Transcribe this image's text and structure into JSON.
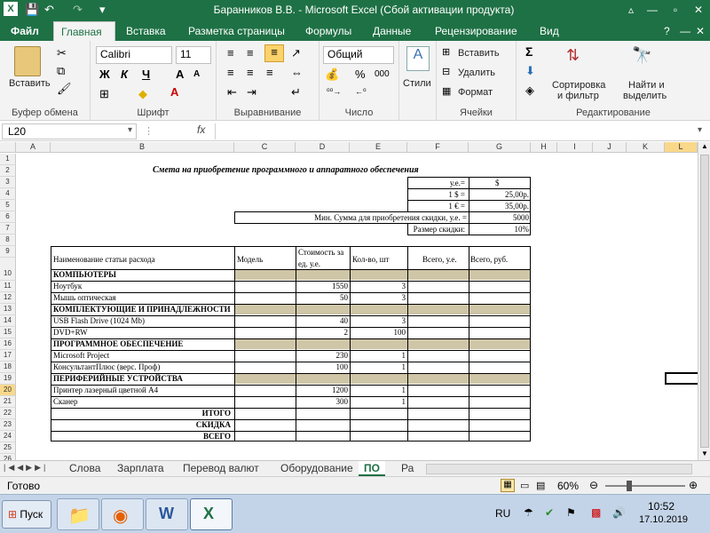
{
  "window": {
    "title": "Баранников В.В.  -  Microsoft Excel (Сбой активации продукта)",
    "minimize": "—",
    "restore": "▫",
    "close": "✕"
  },
  "tabs": [
    "Файл",
    "Главная",
    "Вставка",
    "Разметка страницы",
    "Формулы",
    "Данные",
    "Рецензирование",
    "Вид"
  ],
  "ribbon": {
    "paste_label": "Вставить",
    "clipboard_group": "Буфер обмена",
    "font_name": "Calibri",
    "font_size": "11",
    "bold": "Ж",
    "italic": "К",
    "underline": "Ч",
    "font_group": "Шрифт",
    "align_group": "Выравнивание",
    "number_format": "Общий",
    "percent": "%",
    "thousands": "000",
    "number_group": "Число",
    "styles_label": "Стили",
    "insert_label": "Вставить",
    "delete_label": "Удалить",
    "format_label": "Формат",
    "cells_group": "Ячейки",
    "sigma": "Σ",
    "sort_label": "Сортировка и фильтр",
    "sort_line1": "Сортировка",
    "sort_line2": "и фильтр",
    "find_line1": "Найти и",
    "find_line2": "выделить",
    "editing_group": "Редактирование"
  },
  "formula_bar": {
    "name_box": "L20",
    "fx": "fx",
    "value": ""
  },
  "columns": [
    "A",
    "B",
    "C",
    "D",
    "E",
    "F",
    "G",
    "H",
    "I",
    "J",
    "K",
    "L"
  ],
  "rows": [
    "1",
    "2",
    "3",
    "4",
    "5",
    "6",
    "7",
    "8",
    "9",
    "10",
    "11",
    "12",
    "13",
    "14",
    "15",
    "16",
    "17",
    "18",
    "19",
    "20",
    "21",
    "22",
    "23",
    "24",
    "25",
    "26",
    "27"
  ],
  "sheet": {
    "title": "Смета на приобретение программного и аппаратного обеспечения",
    "rate_hdr_label": "у.е.=",
    "rate_hdr_value": "$",
    "usd_label": "1 $ =",
    "usd_value": "25,00р.",
    "eur_label": "1 € =",
    "eur_value": "35,00р.",
    "min_sum_label": "Мин. Сумма для приобретения скидки, у.е. =",
    "min_sum_value": "5000",
    "discount_label": "Размер скидки:",
    "discount_value": "10%",
    "headers": {
      "name": "Наименование статьи расхода",
      "model": "Модель",
      "cost_l1": "Стоимость за",
      "cost_l2": "ед. у.е.",
      "qty": "Кол-во, шт",
      "total_ue": "Всего, у.е.",
      "total_rub": "Всего, руб."
    },
    "sections": {
      "computers": "КОМПЬЮТЕРЫ",
      "components": "КОМПЛЕКТУЮЩИЕ И ПРИНАДЛЕЖНОСТИ",
      "software": "ПРОГРАММНОЕ ОБЕСПЕЧЕНИЕ",
      "peripherals": "ПЕРИФЕРИЙНЫЕ УСТРОЙСТВА"
    },
    "items": [
      {
        "name": "Ноутбук",
        "price": "1550",
        "qty": "3"
      },
      {
        "name": "Мышь оптическая",
        "price": "50",
        "qty": "3"
      },
      {
        "name": "USB Flash Drive (1024 Mb)",
        "price": "40",
        "qty": "3"
      },
      {
        "name": "DVD+RW",
        "price": "2",
        "qty": "100"
      },
      {
        "name": "Microsoft Project",
        "price": "230",
        "qty": "1"
      },
      {
        "name": "КонсультантПлюс (верс. Проф)",
        "price": "100",
        "qty": "1"
      },
      {
        "name": "Принтер лазерный цветной А4",
        "price": "1200",
        "qty": "1"
      },
      {
        "name": "Сканер",
        "price": "300",
        "qty": "1"
      }
    ],
    "total": "ИТОГО",
    "discount": "СКИДКА",
    "grand_total": "ВСЕГО"
  },
  "sheet_tabs": [
    "Слова",
    "Зарплата",
    "Перевод валют",
    "Оборудование",
    "ПО",
    "Ра"
  ],
  "status": {
    "ready": "Готово",
    "zoom": "60%"
  },
  "taskbar": {
    "start": "Пуск",
    "lang": "RU",
    "time": "10:52",
    "date": "17.10.2019"
  },
  "colors": {
    "excel_green": "#1e7145",
    "section_fill": "#cfc6a8"
  }
}
